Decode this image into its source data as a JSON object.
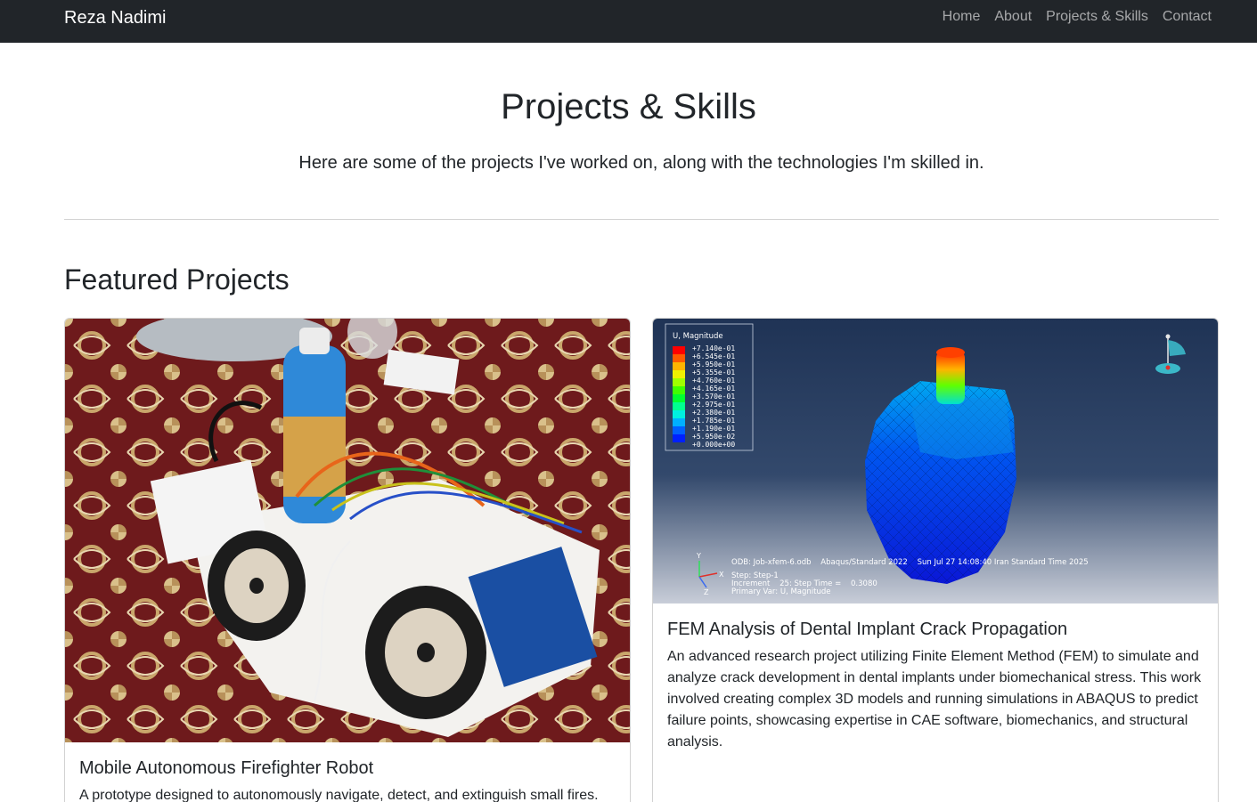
{
  "nav": {
    "brand": "Reza Nadimi",
    "links": [
      "Home",
      "About",
      "Projects & Skills",
      "Contact"
    ]
  },
  "header": {
    "title": "Projects & Skills",
    "lead": "Here are some of the projects I've worked on, along with the technologies I'm skilled in."
  },
  "featured": {
    "title": "Featured Projects",
    "cards": [
      {
        "title": "Mobile Autonomous Firefighter Robot",
        "text": "A prototype designed to autonomously navigate, detect, and extinguish small fires."
      },
      {
        "title": "FEM Analysis of Dental Implant Crack Propagation",
        "text": "An advanced research project utilizing Finite Element Method (FEM) to simulate and analyze crack development in dental implants under biomechanical stress. This work involved creating complex 3D models and running simulations in ABAQUS to predict failure points, showcasing expertise in CAE software, biomechanics, and structural analysis."
      }
    ]
  },
  "fem_image": {
    "legend_title": "U, Magnitude",
    "legend_values": [
      "+7.140e-01",
      "+6.545e-01",
      "+5.950e-01",
      "+5.355e-01",
      "+4.760e-01",
      "+4.165e-01",
      "+3.570e-01",
      "+2.975e-01",
      "+2.380e-01",
      "+1.785e-01",
      "+1.190e-01",
      "+5.950e-02",
      "+0.000e+00"
    ],
    "legend_colors": [
      "#ff0000",
      "#ff5a00",
      "#ffb400",
      "#f0f000",
      "#a0ff00",
      "#40ff00",
      "#00ff30",
      "#00ff90",
      "#00f0e0",
      "#00b0ff",
      "#0060ff",
      "#0020ff",
      "#0000e8"
    ],
    "info_line": "ODB: Job-xfem-6.odb    Abaqus/Standard 2022    Sun Jul 27 14:08:40 Iran Standard Time 2025",
    "step_line": "Step: Step-1",
    "increment_line": "Increment    25: Step Time =    0.3080",
    "var_line": "Primary Var: U, Magnitude",
    "axis_y": "Y",
    "axis_x": "X",
    "axis_z": "Z"
  },
  "colors": {
    "navbar": "#212529",
    "text": "#212529",
    "fem_bg_top": "#1f3355",
    "fem_bg_bottom": "#c8cdd8"
  }
}
